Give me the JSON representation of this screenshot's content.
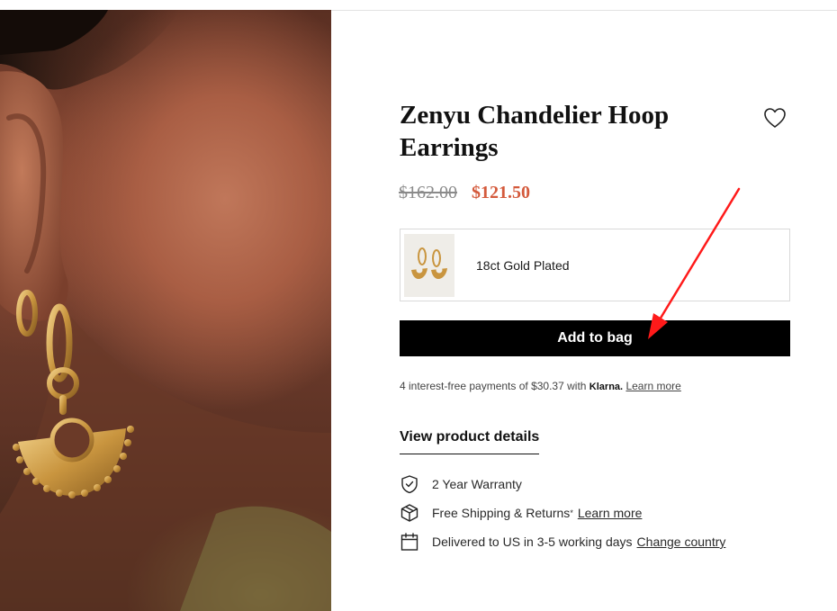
{
  "product": {
    "title": "Zenyu Chandelier Hoop Earrings",
    "price_original": "$162.00",
    "price_sale": "$121.50",
    "sale_color": "#d45a3c"
  },
  "variant": {
    "label": "18ct Gold Plated"
  },
  "actions": {
    "add_to_bag": "Add to bag"
  },
  "klarna": {
    "text": "4 interest-free payments of $30.37 with",
    "brand": "Klarna.",
    "link": "Learn more"
  },
  "details": {
    "view_label": "View product details"
  },
  "features": [
    {
      "icon": "shield-check-icon",
      "text": "2 Year Warranty",
      "link": ""
    },
    {
      "icon": "box-icon",
      "text": "Free Shipping & Returns",
      "mark": "*",
      "link": "Learn more"
    },
    {
      "icon": "calendar-icon",
      "text": "Delivered to US in 3-5 working days",
      "link": "Change country"
    }
  ],
  "icons": {
    "wishlist": "heart-icon"
  },
  "annotation": {
    "type": "red-arrow",
    "color": "#ff1a1a",
    "target": "add-to-bag-button"
  }
}
